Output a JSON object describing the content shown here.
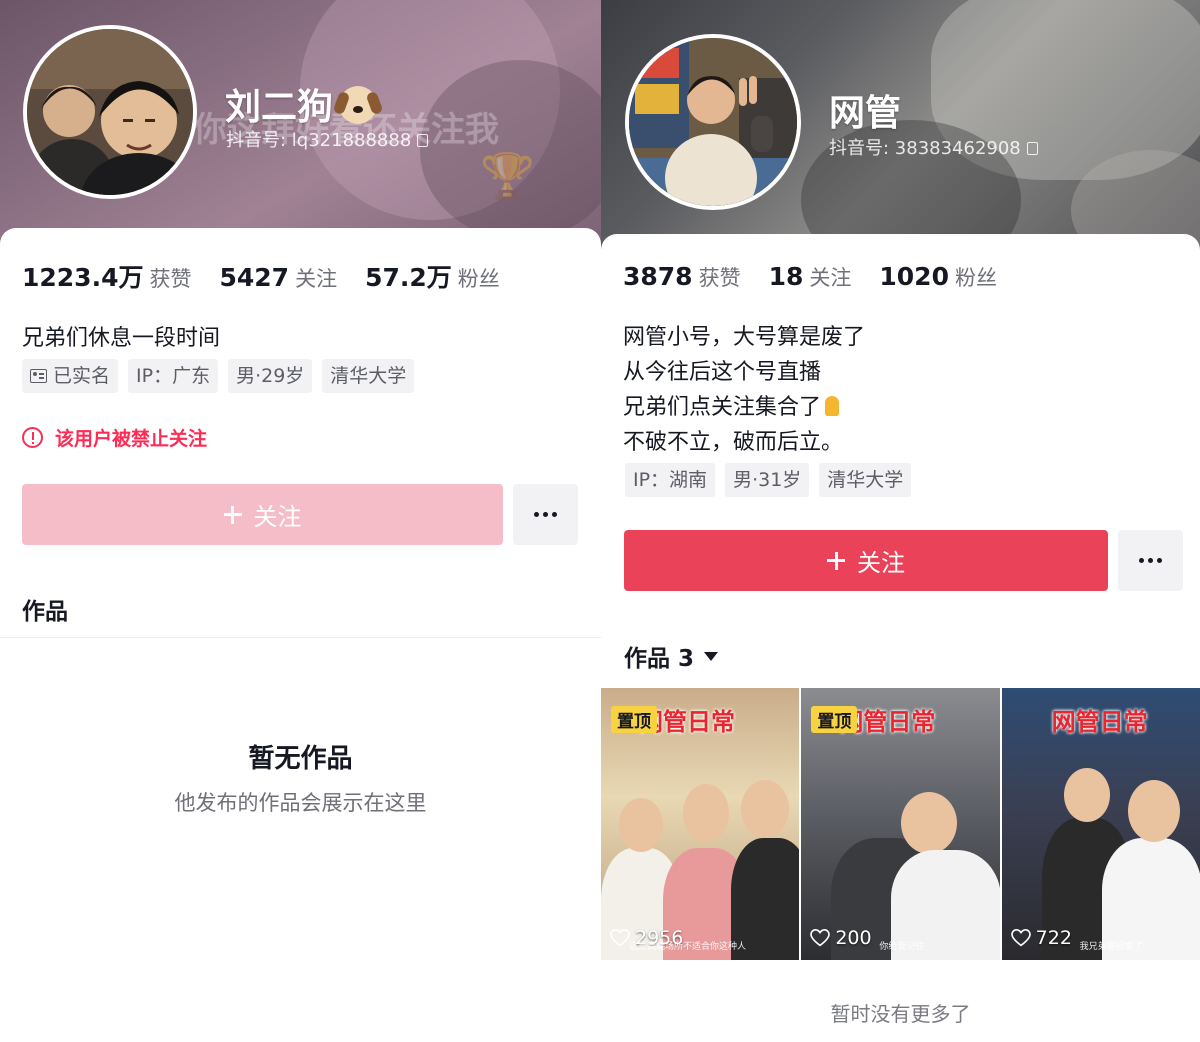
{
  "left_profile": {
    "banner_watermark": "你这拜好看还关注我",
    "nickname": "刘二狗",
    "nickname_emoji": "dog-face",
    "douyin_id": "抖音号: lq321888888",
    "stats": [
      {
        "value": "1223.4万",
        "label": "获赞"
      },
      {
        "value": "5427",
        "label": "关注"
      },
      {
        "value": "57.2万",
        "label": "粉丝"
      }
    ],
    "bio": [
      "兄弟们休息一段时间"
    ],
    "tags": [
      "已实名",
      "IP：广东",
      "男·29岁",
      "清华大学"
    ],
    "warning": "该用户被禁止关注",
    "follow_label": "关注",
    "works_title": "作品",
    "empty_title": "暂无作品",
    "empty_subtitle": "他发布的作品会展示在这里"
  },
  "right_profile": {
    "nickname": "网管",
    "douyin_id": "抖音号: 38383462908",
    "stats": [
      {
        "value": "3878",
        "label": "获赞"
      },
      {
        "value": "18",
        "label": "关注"
      },
      {
        "value": "1020",
        "label": "粉丝"
      }
    ],
    "bio": [
      "网管小号，大号算是废了",
      "从今往后这个号直播",
      "兄弟们点关注集合了",
      "不破不立，破而后立。"
    ],
    "tags": [
      "IP：湖南",
      "男·31岁",
      "清华大学"
    ],
    "follow_label": "关注",
    "works_title": "作品 3",
    "videos": [
      {
        "pinned": true,
        "pin_label": "置顶",
        "title": "网管日常",
        "likes": "2956",
        "subtitle": "这是高端场所不适合你这种人"
      },
      {
        "pinned": true,
        "pin_label": "置顶",
        "title": "网管日常",
        "likes": "200",
        "subtitle": "你给我记住"
      },
      {
        "pinned": false,
        "pin_label": "",
        "title": "网管日常",
        "likes": "722",
        "subtitle": "我兄弟要回家了"
      }
    ],
    "no_more": "暂时没有更多了"
  },
  "colors": {
    "follow_active": "#ea4359",
    "follow_disabled": "#f4bdc8",
    "warning": "#fe2c55",
    "pin_badge": "#f8d341"
  }
}
